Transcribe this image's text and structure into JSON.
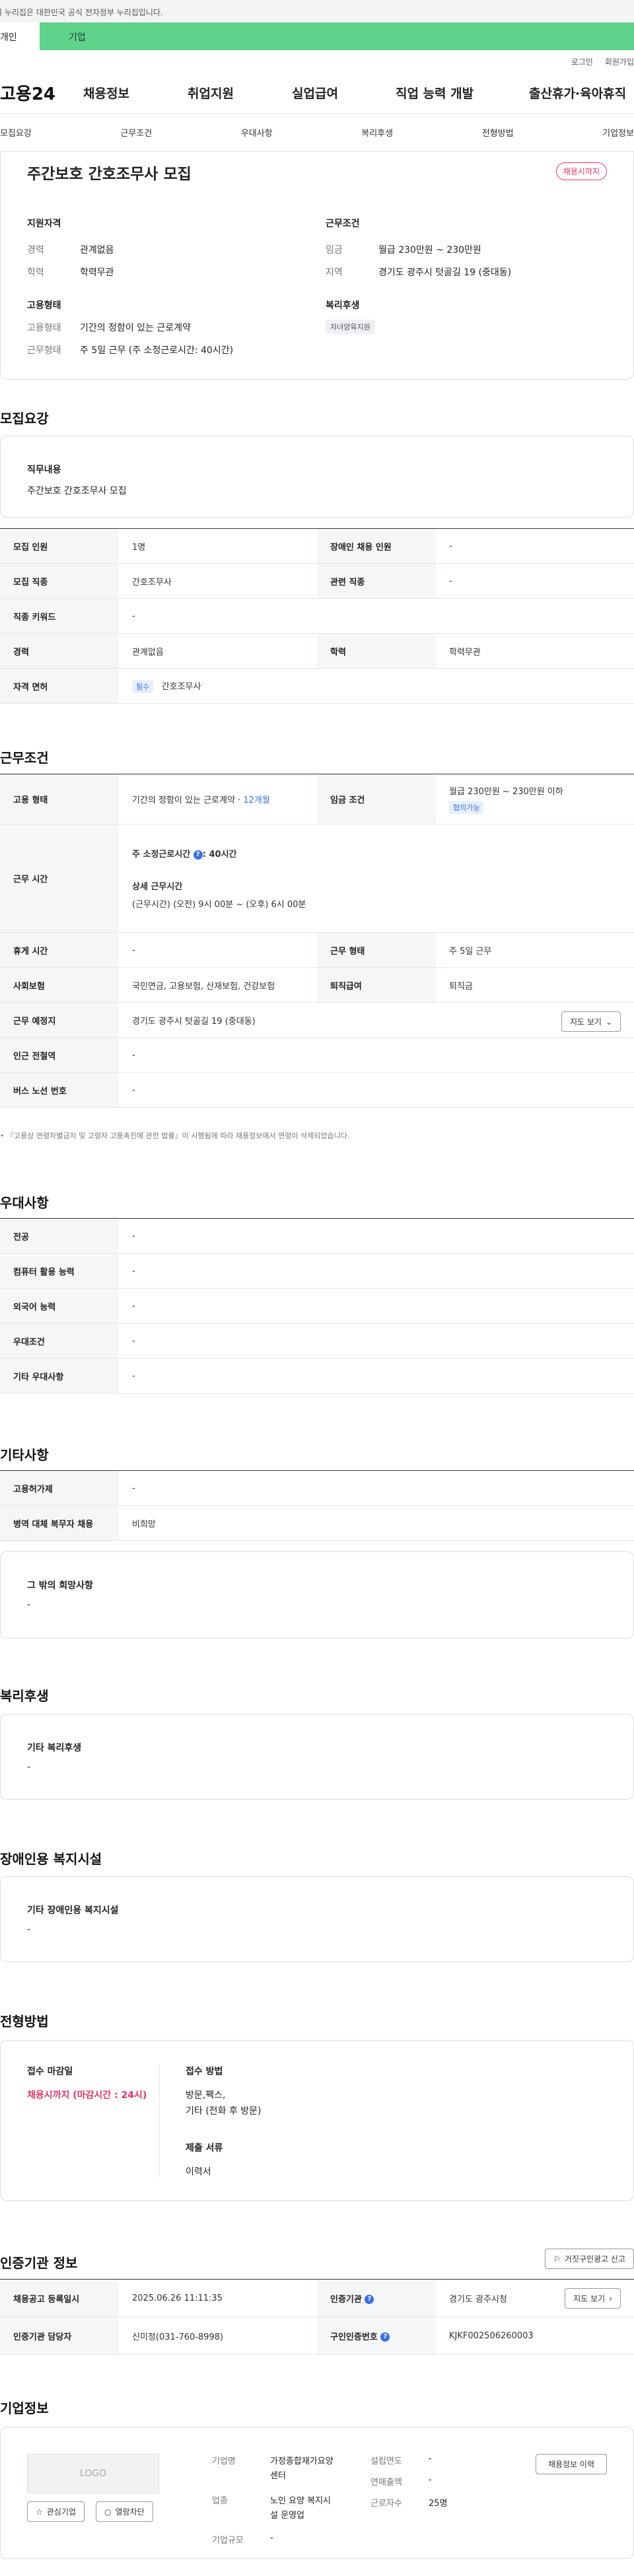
{
  "gov_banner": "이 누리집은 대한민국 공식 전자정부 누리집입니다.",
  "user_type": {
    "personal": "개인",
    "company": "기업"
  },
  "util": {
    "login": "로그인",
    "signup": "회원가입"
  },
  "logo": "고용24",
  "gnb": [
    "채용정보",
    "취업지원",
    "실업급여",
    "직업 능력 개발",
    "출산휴가·육아휴직"
  ],
  "anchors": [
    "모집요강",
    "근무조건",
    "우대사항",
    "복리후생",
    "전형방법",
    "기업정보"
  ],
  "summary": {
    "title": "주간보호 간호조무사 모집",
    "status_badge": "채용시까지",
    "qualification_title": "지원자격",
    "career_label": "경력",
    "career_value": "관계없음",
    "education_label": "학력",
    "education_value": "학력무관",
    "employment_title": "고용형태",
    "emp_type_label": "고용형태",
    "emp_type_value": "기간의 정함이 있는 근로계약",
    "work_form_label": "근무형태",
    "work_form_value": "주 5일 근무 (주 소정근로시간: 40시간)",
    "conditions_title": "근무조건",
    "wage_label": "임금",
    "wage_value": "월급 230만원 ~ 230만원",
    "region_label": "지역",
    "region_value": "경기도 광주시 텃골길 19 (중대동)",
    "welfare_title": "복리후생",
    "welfare_chip": "자녀양육지원"
  },
  "recruit": {
    "title": "모집요강",
    "duty_label": "직무내용",
    "duty_value": "주간보호 간호조무사 모집",
    "rows": [
      {
        "k1": "모집 인원",
        "v1": "1명",
        "k2": "장애인 채용 인원",
        "v2": "-"
      },
      {
        "k1": "모집 직종",
        "v1": "간호조무사",
        "k2": "관련 직종",
        "v2": "-"
      },
      {
        "k1": "직종 키워드",
        "v1": "-"
      },
      {
        "k1": "경력",
        "v1": "관계없음",
        "k2": "학력",
        "v2": "학력무관"
      }
    ],
    "license_label": "자격 면허",
    "license_chip": "필수",
    "license_value": "간호조무사"
  },
  "conditions": {
    "title": "근무조건",
    "emp_type_label": "고용 형태",
    "emp_type_value": "기간의 정함이 있는 근로계약 ·",
    "emp_period": "12개월",
    "wage_label": "임금 조건",
    "wage_value": "월급 230만원 ~ 230만원 이하",
    "wage_chip": "협의가능",
    "hours_label": "근무 시간",
    "weekly_hours_label": "주 소정근로시간",
    "weekly_hours_value": ": 40시간",
    "detail_hours_label": "상세 근무시간",
    "detail_hours_value": "(근무시간) (오전) 9시 00분 ~ (오후) 6시 00분",
    "break_label": "휴게 시간",
    "break_value": "-",
    "work_form_label": "근무 형태",
    "work_form_value": "주 5일 근무",
    "insurance_label": "사회보험",
    "insurance_value": "국민연금, 고용보험, 산재보험, 건강보험",
    "severance_label": "퇴직급여",
    "severance_value": "퇴직금",
    "place_label": "근무 예정지",
    "place_value": "경기도 광주시 텃골길 19 (중대동)",
    "map_button": "지도 보기",
    "subway_label": "인근 전철역",
    "subway_value": "-",
    "bus_label": "버스 노선 번호",
    "bus_value": "-",
    "note": "『고용상 연령차별금지 및 고령자 고용촉진에 관한 법률』이 시행됨에 따라 채용정보에서 연령이 삭제되었습니다."
  },
  "preference": {
    "title": "우대사항",
    "rows": [
      {
        "k": "전공",
        "v": "-"
      },
      {
        "k": "컴퓨터 활용 능력",
        "v": "-"
      },
      {
        "k": "외국어 능력",
        "v": "-"
      },
      {
        "k": "우대조건",
        "v": "-"
      },
      {
        "k": "기타 우대사항",
        "v": "-"
      }
    ]
  },
  "other": {
    "title": "기타사항",
    "rows": [
      {
        "k": "고용허가제",
        "v": "-"
      },
      {
        "k": "병역 대체 복무자 채용",
        "v": "비희망"
      }
    ],
    "hope_label": "그 밖의 희망사항",
    "hope_value": "-"
  },
  "welfare": {
    "title": "복리후생",
    "label": "기타 복리후생",
    "value": "-"
  },
  "disability": {
    "title": "장애인용 복지시설",
    "label": "기타 장애인용 복지시설",
    "value": "-"
  },
  "selection": {
    "title": "전형방법",
    "deadline_label": "접수 마감일",
    "deadline_value": "채용시까지 (마감시간 : 24시)",
    "method_label": "접수 방법",
    "method_value_1": "방문,팩스,",
    "method_value_2": "기타 (전화 후 방문)",
    "docs_label": "제출 서류",
    "docs_value": "이력서"
  },
  "agency": {
    "title": "인증기관 정보",
    "report_button": "거짓구인광고 신고",
    "reg_date_label": "채용공고 등록일시",
    "reg_date_value": "2025.06.26 11:11:35",
    "agency_label": "인증기관",
    "agency_value": "경기도 광주시청",
    "map_button": "지도 보기",
    "manager_label": "인증기관 담당자",
    "manager_value": "신미정(031-760-8998)",
    "number_label": "구인인증번호",
    "number_value": "KJKF002506260003"
  },
  "company": {
    "title": "기업정보",
    "logo_placeholder": "LOGO",
    "fav_button": "관심기업",
    "block_button": "열람차단",
    "name_label": "기업명",
    "name_value_1": "가정종합재가요양",
    "name_value_2": "센터",
    "industry_label": "업종",
    "industry_value_1": "노인 요양 복지시",
    "industry_value_2": "설 운영업",
    "size_label": "기업규모",
    "size_value": "-",
    "founded_label": "설립연도",
    "founded_value": "-",
    "sales_label": "연매출액",
    "sales_value": "-",
    "staff_label": "근로자수",
    "staff_value": "25명",
    "jobs_button": "채용정보 이력"
  }
}
